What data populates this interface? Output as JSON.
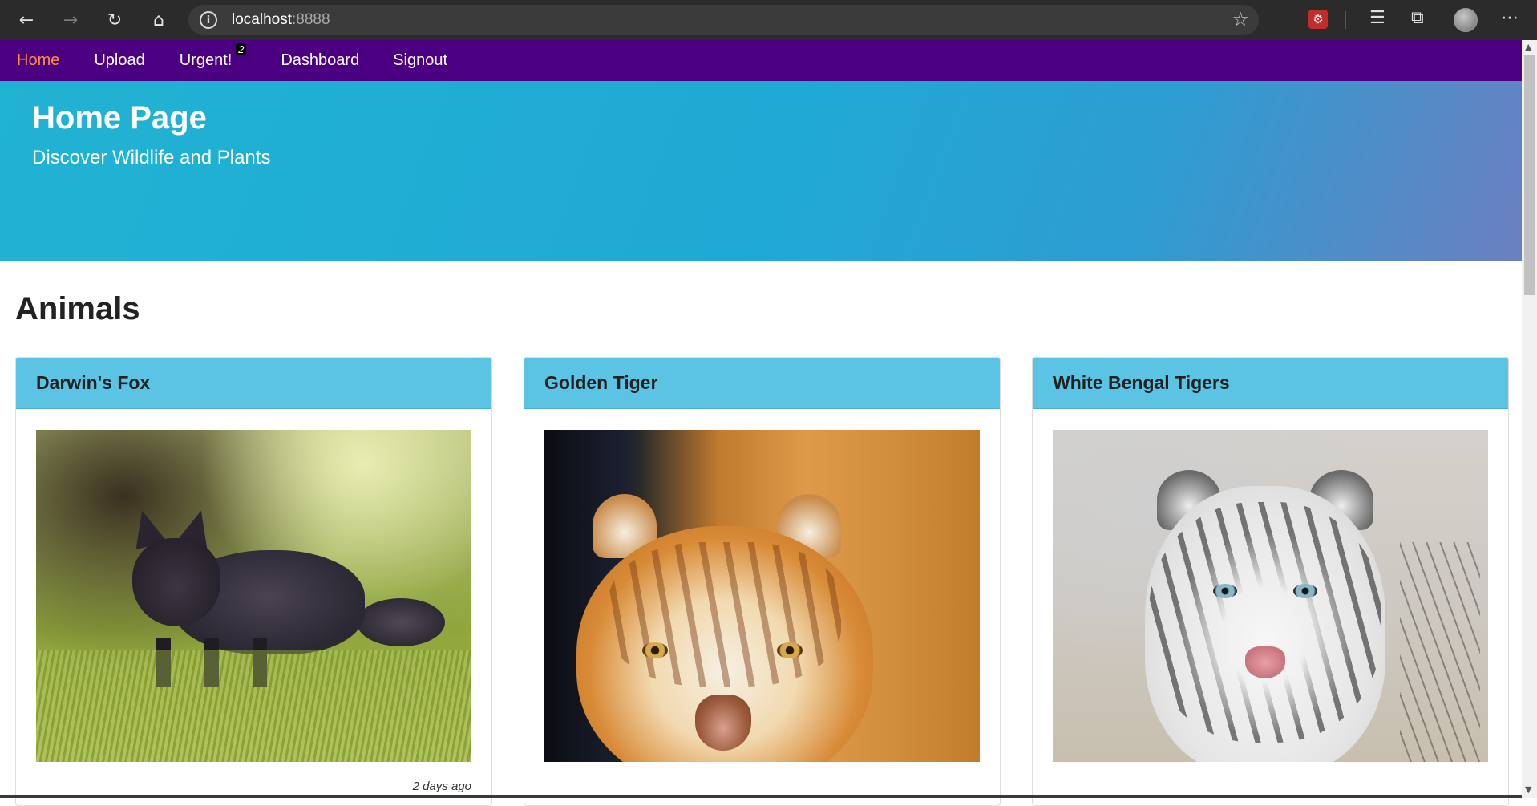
{
  "browser": {
    "url_host": "localhost",
    "url_port": ":8888",
    "back_icon": "back-arrow-icon",
    "forward_icon": "forward-arrow-icon",
    "reload_icon": "reload-icon",
    "home_icon": "home-icon",
    "info_icon": "site-info-icon",
    "favorite_icon": "star-icon",
    "menu_icon": "more-icon"
  },
  "navbar": {
    "color": "#4b0082",
    "active_color": "#ff8c42",
    "items": [
      {
        "label": "Home",
        "active": true
      },
      {
        "label": "Upload",
        "active": false
      },
      {
        "label": "Urgent!",
        "active": false,
        "badge": "2"
      },
      {
        "label": "Dashboard",
        "active": false
      },
      {
        "label": "Signout",
        "active": false
      }
    ]
  },
  "hero": {
    "title": "Home Page",
    "subtitle": "Discover Wildlife and Plants"
  },
  "section": {
    "title": "Animals"
  },
  "cards": [
    {
      "title": "Darwin's Fox",
      "time": "2 days ago"
    },
    {
      "title": "Golden Tiger"
    },
    {
      "title": "White Bengal Tigers"
    }
  ]
}
